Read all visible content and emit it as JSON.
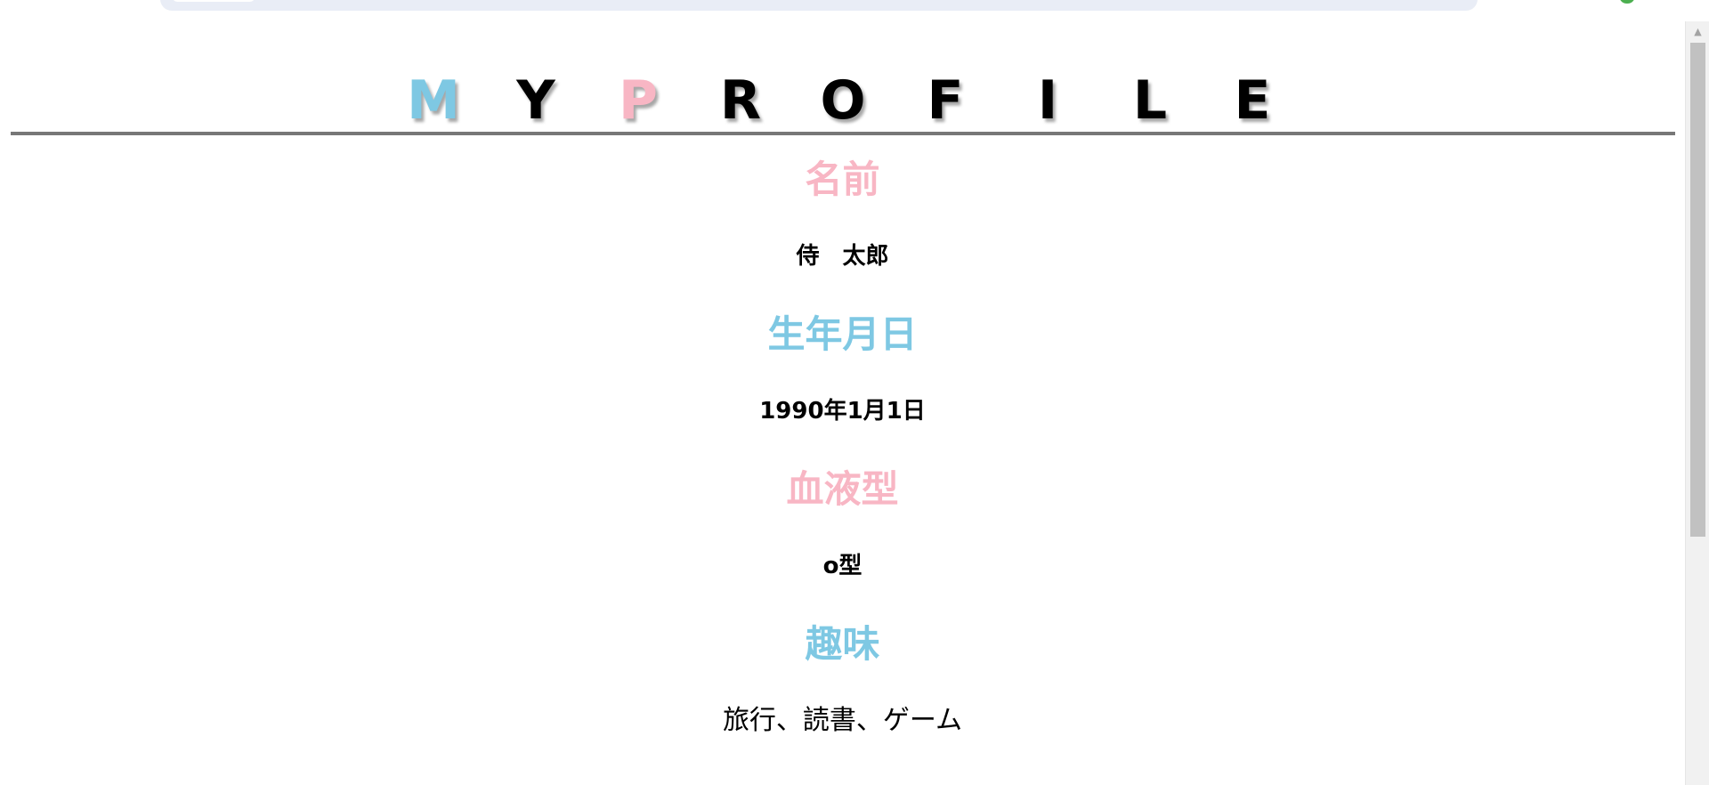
{
  "colors": {
    "accent_blue": "#7ec8e3",
    "accent_pink": "#f8b6c4",
    "text": "#000000",
    "rule": "#777777"
  },
  "logo": {
    "letters": [
      "M",
      "Y",
      "P",
      "R",
      "O",
      "F",
      "I",
      "L",
      "E"
    ],
    "letter_colors": [
      "#7ec8e3",
      "#000000",
      "#f8b6c4",
      "#000000",
      "#000000",
      "#000000",
      "#000000",
      "#000000",
      "#000000"
    ]
  },
  "profile": {
    "name": {
      "label": "名前",
      "value": "侍　太郎"
    },
    "birthday": {
      "label": "生年月日",
      "value": "1990年1月1日"
    },
    "blood_type": {
      "label": "血液型",
      "value": "o型"
    },
    "hobby": {
      "label": "趣味",
      "value": "旅行、読書、ゲーム"
    }
  }
}
